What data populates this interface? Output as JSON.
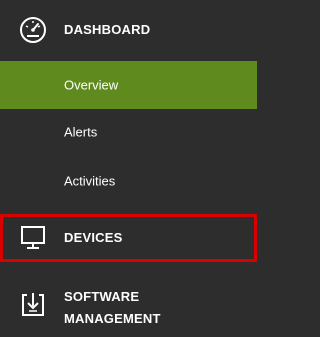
{
  "nav": {
    "dashboard": {
      "label": "DASHBOARD",
      "icon": "dashboard-gauge-icon"
    },
    "sub_items": [
      {
        "label": "Overview",
        "active": true
      },
      {
        "label": "Alerts",
        "active": false
      },
      {
        "label": "Activities",
        "active": false
      }
    ],
    "devices": {
      "label": "DEVICES",
      "icon": "monitor-icon",
      "highlighted": true
    },
    "software": {
      "label_line1": "SOFTWARE",
      "label_line2": "MANAGEMENT",
      "icon": "software-download-icon"
    }
  },
  "colors": {
    "background": "#2d2d2d",
    "active_item": "#5f8b1e",
    "highlight_border": "#d90000",
    "text": "#ffffff"
  }
}
